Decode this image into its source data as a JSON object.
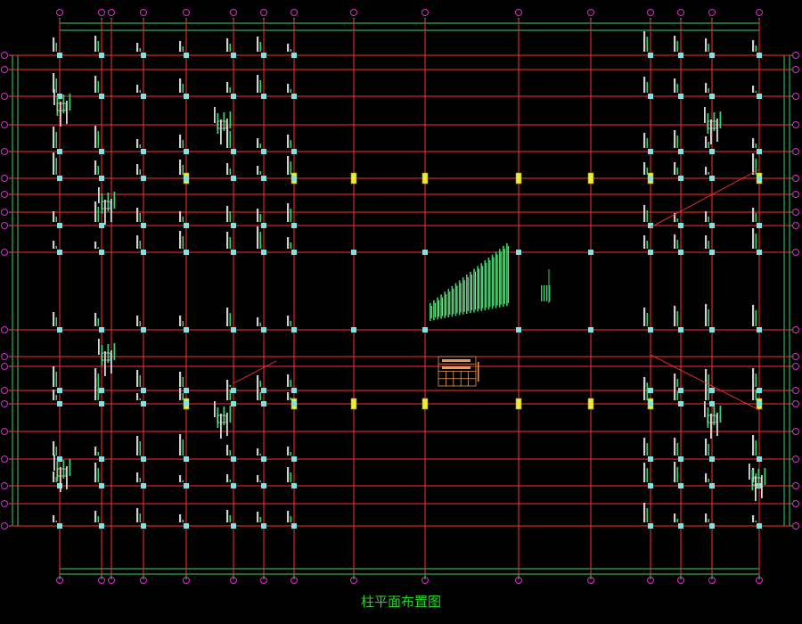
{
  "drawing": {
    "title": "柱平面布置图",
    "colors": {
      "background": "#000000",
      "grid_line": "#ff3030",
      "dimension_line": "#36d36a",
      "axis_bubble": "#e02ad0",
      "column_small": "#7fe3e3",
      "column_large": "#ecec3a",
      "table_outline": "#e89a5a",
      "title": "#2bd12b"
    }
  }
}
